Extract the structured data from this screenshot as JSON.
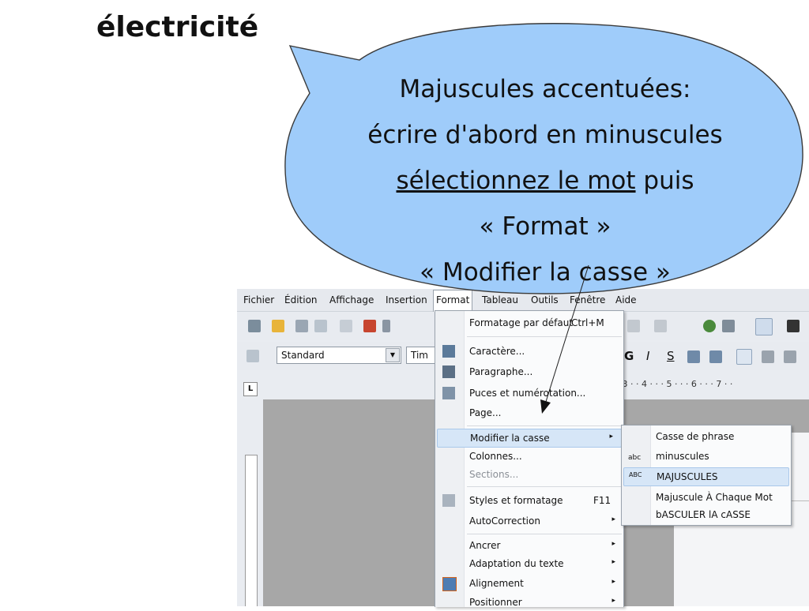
{
  "slide": {
    "title": "électricité",
    "bubble": {
      "line1": "Majuscules accentuées:",
      "line2": "écrire d'abord en minuscules",
      "line3_underlined": "sélectionnez le mot",
      "line3_rest": " puis",
      "line4": "« Format »",
      "line5": "« Modifier la casse »",
      "fill": "#9fccfa",
      "stroke": "#3a3a3a"
    }
  },
  "menubar": {
    "items": [
      "Fichier",
      "Édition",
      "Affichage",
      "Insertion",
      "Format",
      "Tableau",
      "Outils",
      "Fenêtre",
      "Aide"
    ],
    "active": "Format"
  },
  "toolbar": {
    "style_combo": "Standard",
    "font_combo": "Tim",
    "bold": "G",
    "italic": "I",
    "underline": "S"
  },
  "ruler": {
    "corner": "L",
    "marks": "1 · 3 · · 4 · · · 5 · · · 6 · · · 7 · ·"
  },
  "format_menu": {
    "items": [
      {
        "label": "Formatage par défaut",
        "shortcut": "Ctrl+M",
        "icon": "none"
      },
      {
        "label": "Caractère...",
        "icon": "character-icon"
      },
      {
        "label": "Paragraphe...",
        "icon": "paragraph-icon"
      },
      {
        "label": "Puces et numérotation...",
        "icon": "bullets-icon"
      },
      {
        "label": "Page...",
        "icon": "none"
      },
      {
        "label": "Modifier la casse",
        "submenu": true,
        "highlighted": true
      },
      {
        "label": "Colonnes...",
        "icon": "none"
      },
      {
        "label": "Sections...",
        "disabled": true
      },
      {
        "label": "Styles et formatage",
        "shortcut": "F11",
        "icon": "styles-icon"
      },
      {
        "label": "AutoCorrection",
        "submenu": true
      },
      {
        "label": "Ancrer",
        "submenu": true
      },
      {
        "label": "Adaptation du texte",
        "submenu": true
      },
      {
        "label": "Alignement",
        "submenu": true,
        "icon": "alignment-icon"
      },
      {
        "label": "Positionner",
        "submenu": true
      }
    ]
  },
  "case_submenu": {
    "items": [
      {
        "label": "Casse de phrase"
      },
      {
        "label": "minuscules",
        "icon": "lowercase-icon",
        "icon_text": "abc"
      },
      {
        "label": "MAJUSCULES",
        "icon": "uppercase-icon",
        "icon_text": "ABC",
        "hovered": true
      },
      {
        "label": "Majuscule À Chaque Mot"
      },
      {
        "label": "bASCULER lA cASSE"
      }
    ]
  }
}
